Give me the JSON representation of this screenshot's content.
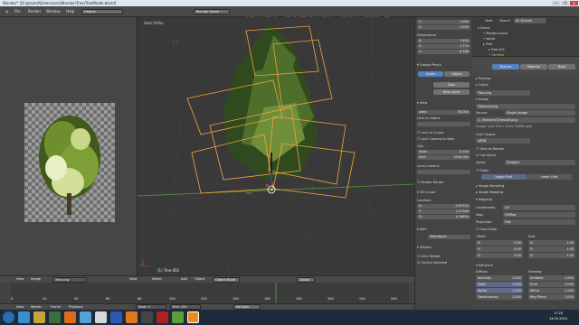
{
  "window": {
    "title": "Blender* [D:\\gmjmd\\Extensions\\Blender\\Tree\\TreeModel.blend]",
    "controls": [
      "—",
      "❐",
      "✕"
    ]
  },
  "menubar": {
    "items": [
      "File",
      "Render",
      "Window",
      "Help"
    ],
    "layout": "Default",
    "engine": "Blender Game",
    "info": "v2.70 | Verts:562 | Faces:298 | Tris:573 | Objects:1/2 | Lamps:0/1 | Memory:7.00M | Tree.009"
  },
  "left_panel": {
    "image_name": "Tree.png",
    "header_items": [
      "View",
      "Image",
      "Tree.png",
      "Image*"
    ]
  },
  "viewport": {
    "label": "User Ortho",
    "object_label": "(1) Tree.001",
    "header_items": [
      "View",
      "Select",
      "Add",
      "Object",
      "Object Mode",
      "Global"
    ]
  },
  "timeline": {
    "items": [
      "View",
      "Marker",
      "Frame",
      "Playback",
      "Start: 1",
      "End: 250",
      "No Sync"
    ],
    "ticks": [
      "0",
      "20",
      "40",
      "60",
      "80",
      "100",
      "120",
      "140",
      "160",
      "180",
      "200",
      "220",
      "240"
    ]
  },
  "n_panel": {
    "dimensions_label": "Dimensions:",
    "dims": [
      {
        "k": "X:",
        "v": "7.494"
      },
      {
        "k": "Y:",
        "v": "7.774"
      },
      {
        "k": "Z:",
        "v": "8.188"
      }
    ],
    "top_fields": [
      {
        "k": "Y:",
        "v": "1.000"
      },
      {
        "k": "Z:",
        "v": "1.000"
      }
    ],
    "grease_pencil": "Grease Pencil",
    "scene_tab": "Scene",
    "object_tab": "Object",
    "new_btn": "New",
    "new_layer_btn": "New Layer",
    "view_label": "View",
    "lens_label": "Lens:",
    "lens_value": "35.000",
    "lock_label": "Lock to Object:",
    "lock_cursor": "Lock to Cursor",
    "lock_camera": "Lock Camera to View",
    "clip_label": "Clip:",
    "clip_start": {
      "k": "Start:",
      "v": "0.100"
    },
    "clip_end": {
      "k": "End:",
      "v": "1000.000"
    },
    "local_cam": "Local Camera:",
    "render_border": "Render Border",
    "cursor_label": "3D Cursor",
    "location_label": "Location:",
    "loc": [
      {
        "k": "X:",
        "v": "0.92715"
      },
      {
        "k": "Y:",
        "v": "2.27160"
      },
      {
        "k": "Z:",
        "v": "4.70654"
      }
    ],
    "item_label": "Item",
    "item_name": "TreeObject",
    "display_label": "Display",
    "only_render": "Only Render",
    "outline": "Outline Selected"
  },
  "outliner": {
    "view_label": "View",
    "search_label": "Search",
    "scope": "All Scenes",
    "items": [
      "Scene",
      "RenderLayers",
      "World",
      "Tree",
      "Tree.001",
      "TreeMat"
    ]
  },
  "properties": {
    "tabs": [
      "Texture",
      "Material",
      "Both"
    ],
    "preview": "Preview",
    "colors": "Colors",
    "influence_label": "Influence",
    "texture_name": "Tree.png",
    "image_label": "Image",
    "tex_file": "TreeLeaf.png",
    "source_label": "Source:",
    "source_value": "Single Image",
    "path": "//..\\Textures\\TreeLeaf.png",
    "info": "Image: size 700 x 1024, RGBA byte",
    "color_space_label": "Color Space:",
    "color_space_value": "sRGB",
    "view_as_render": "View as Render",
    "use_alpha": "Use Alpha",
    "alpha_label": "Alpha:",
    "alpha_value": "Straight",
    "fields": "Fields",
    "upper_first": "Upper First",
    "lower_first": "Lower First",
    "sampling": "Image Sampling",
    "mapping_img": "Image Mapping",
    "mapping": "Mapping",
    "coordinates_label": "Coordinates:",
    "coordinates_value": "UV",
    "map_label": "Map:",
    "map_value": "UVMap",
    "projection_label": "Projection:",
    "projection_value": "Flat",
    "from_dupli": "From Dupli",
    "offset_label": "Offset:",
    "size_label": "Size:",
    "offsets": [
      {
        "k": "X:",
        "v": "0.00"
      },
      {
        "k": "Y:",
        "v": "0.00"
      },
      {
        "k": "Z:",
        "v": "0.00"
      }
    ],
    "sizes": [
      {
        "k": "X:",
        "v": "1.00"
      },
      {
        "k": "Y:",
        "v": "1.00"
      },
      {
        "k": "Z:",
        "v": "1.00"
      }
    ],
    "diffuse_label": "Diffuse:",
    "shading_label": "Shading:",
    "infl": [
      {
        "k": "Intensity",
        "v": "1.000"
      },
      {
        "k": "Color",
        "v": "1.000"
      },
      {
        "k": "Alpha",
        "v": "1.000"
      },
      {
        "k": "Translucency",
        "v": "1.000"
      }
    ],
    "shading": [
      {
        "k": "Ambient",
        "v": "1.000"
      },
      {
        "k": "Emit",
        "v": "1.000"
      },
      {
        "k": "Mirror",
        "v": "1.000"
      },
      {
        "k": "Ray Mirror",
        "v": "1.000"
      }
    ]
  },
  "taskbar": {
    "time": "17:25",
    "date": "14.05.2014"
  },
  "colors": {
    "selection_orange": "#f5a53a",
    "active_blue": "#5680c2",
    "taskbar": "#1d2b3a"
  }
}
